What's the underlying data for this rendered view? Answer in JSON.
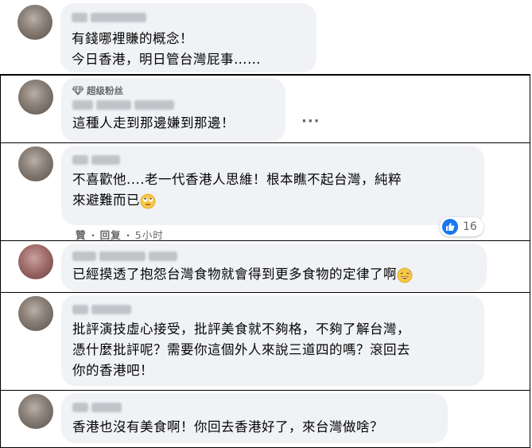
{
  "comments": [
    {
      "id": "c1",
      "lines": [
        "有錢哪裡賺的概念！",
        "今日香港，明日管台灣屁事……"
      ]
    },
    {
      "id": "c2",
      "badge": "超级粉丝",
      "lines": [
        "這種人走到那邊嫌到那邊！"
      ],
      "more_label": "···"
    },
    {
      "id": "c3",
      "lines": [
        "不喜歡他....老一代香港人思維！根本瞧不起台灣，純粹",
        "來避難而已"
      ],
      "reaction_count": "16",
      "actions": {
        "like": "贊",
        "reply": "回复",
        "time": "5小时"
      }
    },
    {
      "id": "c4",
      "lines": [
        "已經摸透了抱怨台灣食物就會得到更多食物的定律了啊"
      ]
    },
    {
      "id": "c5",
      "lines": [
        "批評演技虛心接受，批評美食就不夠格，不夠了解台灣，",
        "憑什麼批評呢？需要你這個外人來說三道四的嗎？滾回去",
        "你的香港吧！"
      ]
    },
    {
      "id": "c6",
      "lines": [
        "香港也沒有美食啊！你回去香港好了，來台灣做啥？"
      ]
    }
  ],
  "icons": {
    "badge": "diamond-icon",
    "reaction": "thumbs-up-icon",
    "emoji_roll": "face-with-rolling-eyes-icon",
    "emoji_grin": "grinning-face-with-sweat-icon"
  },
  "colors": {
    "bubble": "#f0f2f5",
    "like_blue": "#1877f2",
    "meta_gray": "#65676b"
  }
}
